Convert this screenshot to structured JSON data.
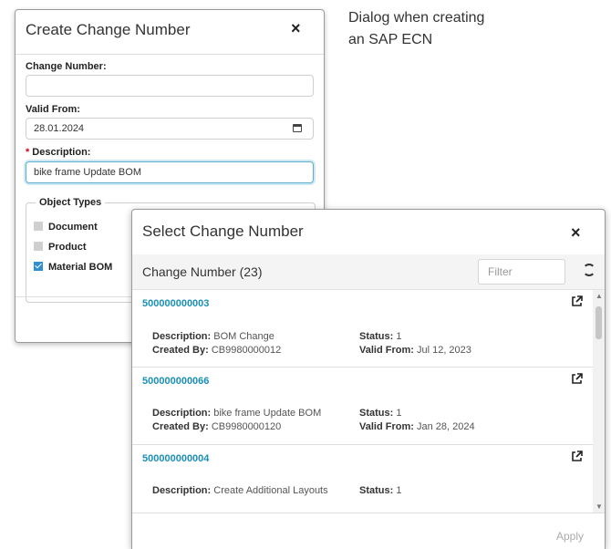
{
  "caption": {
    "line1": "Dialog when creating",
    "line2": "an SAP ECN"
  },
  "create_dialog": {
    "title": "Create Change Number",
    "close": "×",
    "change_number_label": "Change Number:",
    "change_number_value": "",
    "valid_from_label": "Valid From:",
    "valid_from_value": "28.01.2024",
    "description_required": "*",
    "description_label": "Description:",
    "description_value": "bike frame Update BOM",
    "object_types_legend": "Object Types",
    "object_types": [
      {
        "label": "Document",
        "checked": false
      },
      {
        "label": "Product",
        "checked": false
      },
      {
        "label": "Material BOM",
        "checked": true
      }
    ]
  },
  "select_dialog": {
    "title": "Select Change Number",
    "close": "×",
    "heading": "Change Number (23)",
    "filter_placeholder": "Filter",
    "apply_label": "Apply",
    "items": [
      {
        "number": "500000000003",
        "description_label": "Description:",
        "description": "BOM Change",
        "created_by_label": "Created By:",
        "created_by": "CB9980000012",
        "status_label": "Status:",
        "status": "1",
        "valid_from_label": "Valid From:",
        "valid_from": "Jul 12, 2023"
      },
      {
        "number": "500000000066",
        "description_label": "Description:",
        "description": "bike frame Update BOM",
        "created_by_label": "Created By:",
        "created_by": "CB9980000120",
        "status_label": "Status:",
        "status": "1",
        "valid_from_label": "Valid From:",
        "valid_from": "Jan 28, 2024"
      },
      {
        "number": "500000000004",
        "description_label": "Description:",
        "description": "Create Additional Layouts",
        "status_label": "Status:",
        "status": "1"
      }
    ]
  },
  "colors": {
    "link": "#1a8fb5",
    "checkbox_checked": "#2f8fd1",
    "required": "#d0021b"
  }
}
